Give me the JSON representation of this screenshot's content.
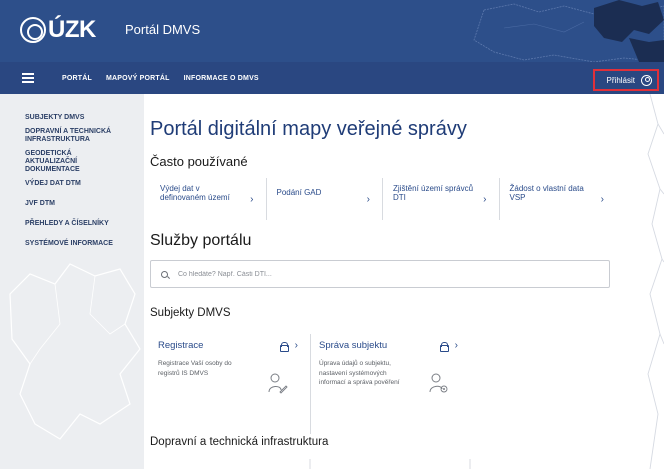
{
  "header": {
    "logo_text": "ÚZK",
    "portal_name": "Portál DMVS"
  },
  "nav": {
    "items": [
      {
        "label": "PORTÁL"
      },
      {
        "label": "MAPOVÝ PORTÁL"
      },
      {
        "label": "INFORMACE O DMVS"
      }
    ],
    "login_label": "Přihlásit"
  },
  "sidebar": {
    "items": [
      {
        "label": "SUBJEKTY DMVS"
      },
      {
        "label": "DOPRAVNÍ A TECHNICKÁ\nINFRASTRUKTURA"
      },
      {
        "label": "GEODETICKÁ\nAKTUALIZAČNÍ\nDOKUMENTACE"
      },
      {
        "label": "VÝDEJ DAT DTM"
      },
      {
        "label": "JVF DTM"
      },
      {
        "label": "PŘEHLEDY A ČÍSELNÍKY"
      },
      {
        "label": "SYSTÉMOVÉ INFORMACE"
      }
    ]
  },
  "main": {
    "title": "Portál digitální mapy veřejné správy",
    "frequent_title": "Často používané",
    "quick_links": [
      {
        "label": "Výdej dat v definovaném území"
      },
      {
        "label": "Podání GAD"
      },
      {
        "label": "Zjištění území správců DTI"
      },
      {
        "label": "Žádost o vlastní data VSP"
      }
    ],
    "services_title": "Služby portálu",
    "search": {
      "placeholder": "Co hledáte? Např. Části DTI..."
    },
    "subjects_title": "Subjekty DMVS",
    "cards": [
      {
        "title": "Registrace",
        "description": "Registrace Vaší osoby do registrů IS DMVS"
      },
      {
        "title": "Správa subjektu",
        "description": "Úprava údajů o subjektu, nastavení systémových informací a správa pověření"
      }
    ],
    "infrastructure_title": "Dopravní a technická infrastruktura"
  },
  "colors": {
    "header_bg": "#2d4f8a",
    "nav_bg": "#2a4781",
    "sidebar_bg": "#eceef1",
    "accent": "#2a4b8a",
    "highlight_border": "#e0303a"
  },
  "icons": {
    "menu": "hamburger-icon",
    "user": "user-circle-icon",
    "search": "search-icon",
    "lock": "lock-icon",
    "chevron": "chevron-right-icon"
  }
}
